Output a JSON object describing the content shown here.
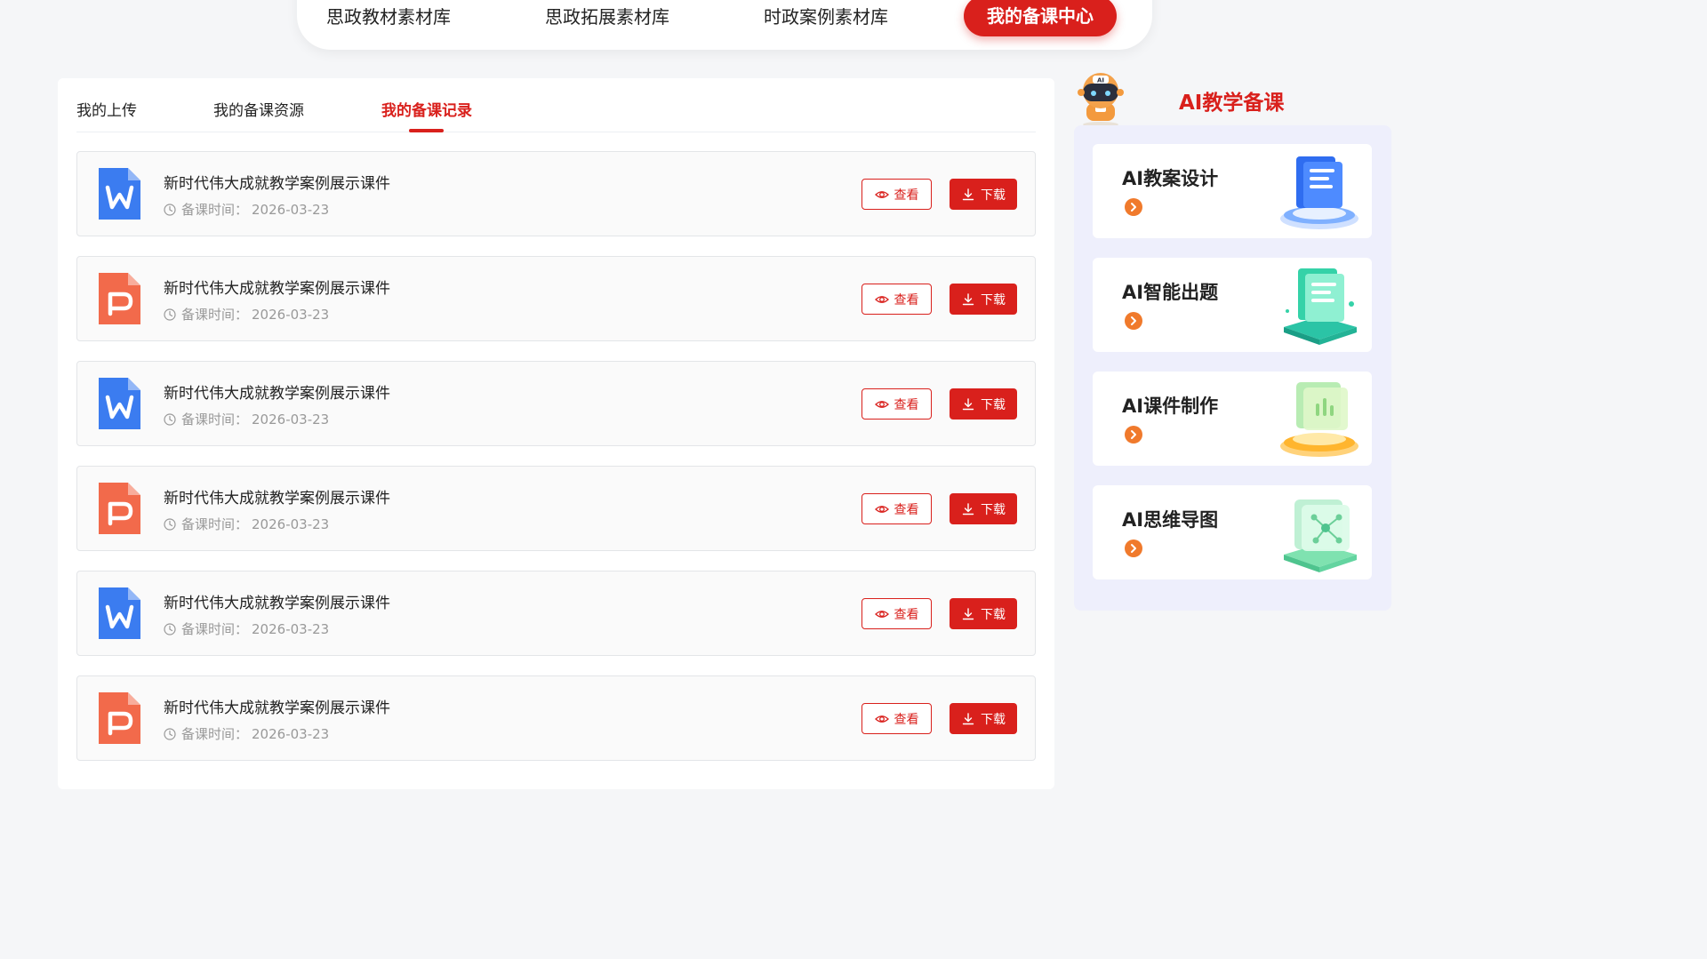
{
  "topnav": {
    "items": [
      {
        "label": "思政教材素材库"
      },
      {
        "label": "思政拓展素材库"
      },
      {
        "label": "时政案例素材库"
      },
      {
        "label": "我的备课中心"
      }
    ]
  },
  "tabs": [
    {
      "label": "我的上传"
    },
    {
      "label": "我的备课资源"
    },
    {
      "label": "我的备课记录"
    }
  ],
  "records": [
    {
      "type": "word",
      "title": "新时代伟大成就教学案例展示课件",
      "meta_label": "备课时间：",
      "date": "2026-03-23",
      "view_label": "查看",
      "download_label": "下载"
    },
    {
      "type": "ppt",
      "title": "新时代伟大成就教学案例展示课件",
      "meta_label": "备课时间：",
      "date": "2026-03-23",
      "view_label": "查看",
      "download_label": "下载"
    },
    {
      "type": "word",
      "title": "新时代伟大成就教学案例展示课件",
      "meta_label": "备课时间：",
      "date": "2026-03-23",
      "view_label": "查看",
      "download_label": "下载"
    },
    {
      "type": "ppt",
      "title": "新时代伟大成就教学案例展示课件",
      "meta_label": "备课时间：",
      "date": "2026-03-23",
      "view_label": "查看",
      "download_label": "下载"
    },
    {
      "type": "word",
      "title": "新时代伟大成就教学案例展示课件",
      "meta_label": "备课时间：",
      "date": "2026-03-23",
      "view_label": "查看",
      "download_label": "下载"
    },
    {
      "type": "ppt",
      "title": "新时代伟大成就教学案例展示课件",
      "meta_label": "备课时间：",
      "date": "2026-03-23",
      "view_label": "查看",
      "download_label": "下载"
    }
  ],
  "side": {
    "title": "AI教学备课",
    "robot_badge": "AI",
    "cards": [
      {
        "label": "AI教案设计",
        "icon": "document-stack-icon"
      },
      {
        "label": "AI智能出题",
        "icon": "question-paper-icon"
      },
      {
        "label": "AI课件制作",
        "icon": "courseware-icon"
      },
      {
        "label": "AI思维导图",
        "icon": "mindmap-icon"
      }
    ]
  },
  "colors": {
    "brand": "#d9201c",
    "word": "#3b7cf0",
    "ppt": "#f26a4b",
    "arrow": "#f07a2c",
    "side_bg": "#eeeffc"
  }
}
